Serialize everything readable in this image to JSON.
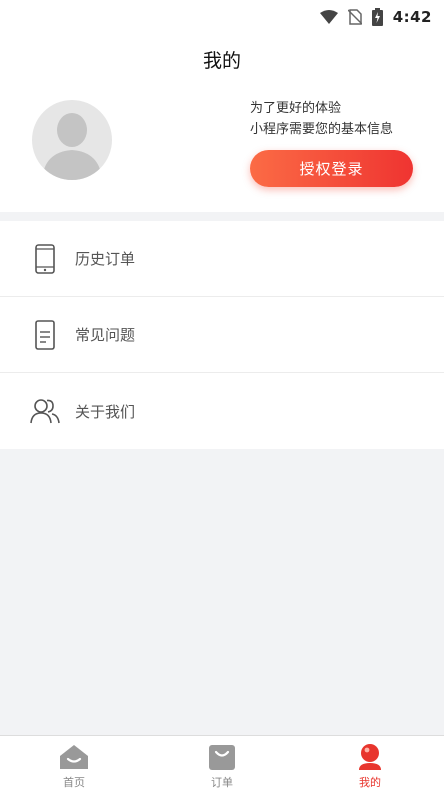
{
  "status_bar": {
    "time": "4:42",
    "icons": [
      "wifi-icon",
      "no-sim-icon",
      "battery-charging-icon"
    ]
  },
  "header": {
    "title": "我的"
  },
  "profile": {
    "avatar_icon": "default-avatar-icon",
    "auth_line1": "为了更好的体验",
    "auth_line2": "小程序需要您的基本信息",
    "login_label": "授权登录"
  },
  "menu": {
    "items": [
      {
        "label": "历史订单",
        "icon": "phone-icon"
      },
      {
        "label": "常见问题",
        "icon": "document-icon"
      },
      {
        "label": "关于我们",
        "icon": "users-icon"
      }
    ]
  },
  "tabbar": {
    "tabs": [
      {
        "label": "首页",
        "icon": "home-icon"
      },
      {
        "label": "订单",
        "icon": "shopping-bag-icon"
      },
      {
        "label": "我的",
        "icon": "user-icon",
        "active": true
      }
    ],
    "active_color": "#e8352d",
    "inactive_color": "#888888"
  },
  "colors": {
    "accent_gradient_start": "#fb6b45",
    "accent_gradient_end": "#ef3431",
    "background": "#f2f3f5"
  }
}
